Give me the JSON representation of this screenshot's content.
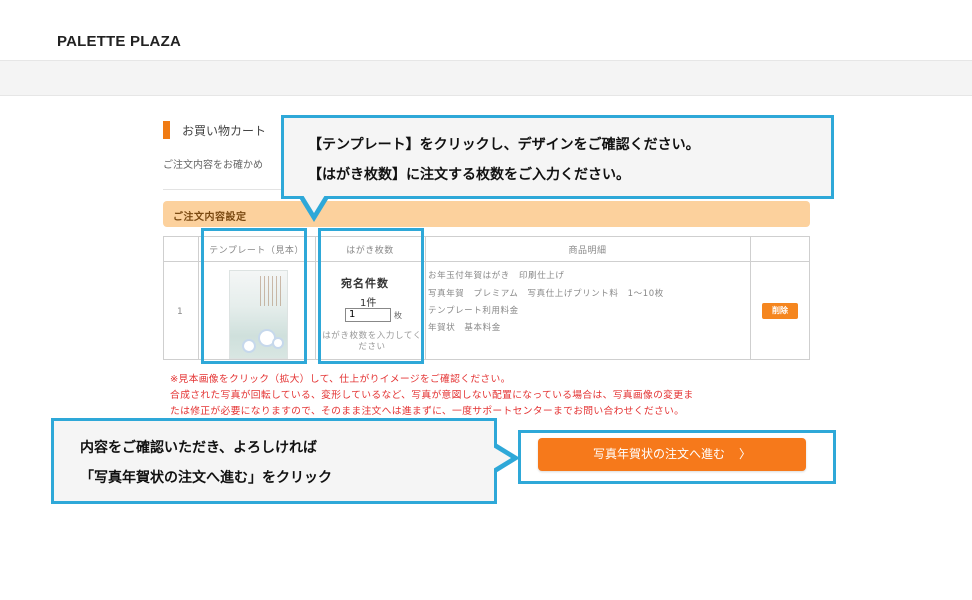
{
  "header": {
    "logo": "PALETTE PLAZA"
  },
  "cart": {
    "title": "お買い物カート",
    "confirm_text": "ご注文内容をお確かめ",
    "order_section_title": "ご注文内容設定"
  },
  "table": {
    "headers": [
      "テンプレート（見本）",
      "はがき枚数",
      "商品明細"
    ],
    "row_number": "1",
    "quantity": {
      "title": "宛名件数",
      "count": "1件",
      "input_value": "1",
      "unit": "枚",
      "help": "はがき枚数を入力してください"
    },
    "details": [
      "お年玉付年賀はがき　印刷仕上げ",
      "写真年賀　プレミアム　写真仕上げプリント料　1～10枚",
      "テンプレート利用料金",
      "年賀状　基本料金"
    ],
    "delete_label": "削除"
  },
  "notes": [
    "※見本画像をクリック（拡大）して、仕上がりイメージをご確認ください。",
    "合成された写真が回転している、変形しているなど、写真が意図しない配置になっている場合は、写真画像の変更ま",
    "たは修正が必要になりますので、そのまま注文へは進まずに、一度サポートセンターまでお問い合わせください。"
  ],
  "proceed_button": {
    "label": "写真年賀状の注文へ進む",
    "chevron": "〉"
  },
  "callouts": {
    "top": [
      "【テンプレート】をクリックし、デザインをご確認ください。",
      "【はがき枚数】に注文する枚数をご入力ください。"
    ],
    "bottom": [
      "内容をご確認いただき、よろしければ",
      "「写真年賀状の注文へ進む」をクリック"
    ]
  },
  "colors": {
    "accent_orange": "#f6791b",
    "section_bg": "#fcd19d",
    "highlight_blue": "#2ea8d8",
    "note_red": "#e43434"
  }
}
